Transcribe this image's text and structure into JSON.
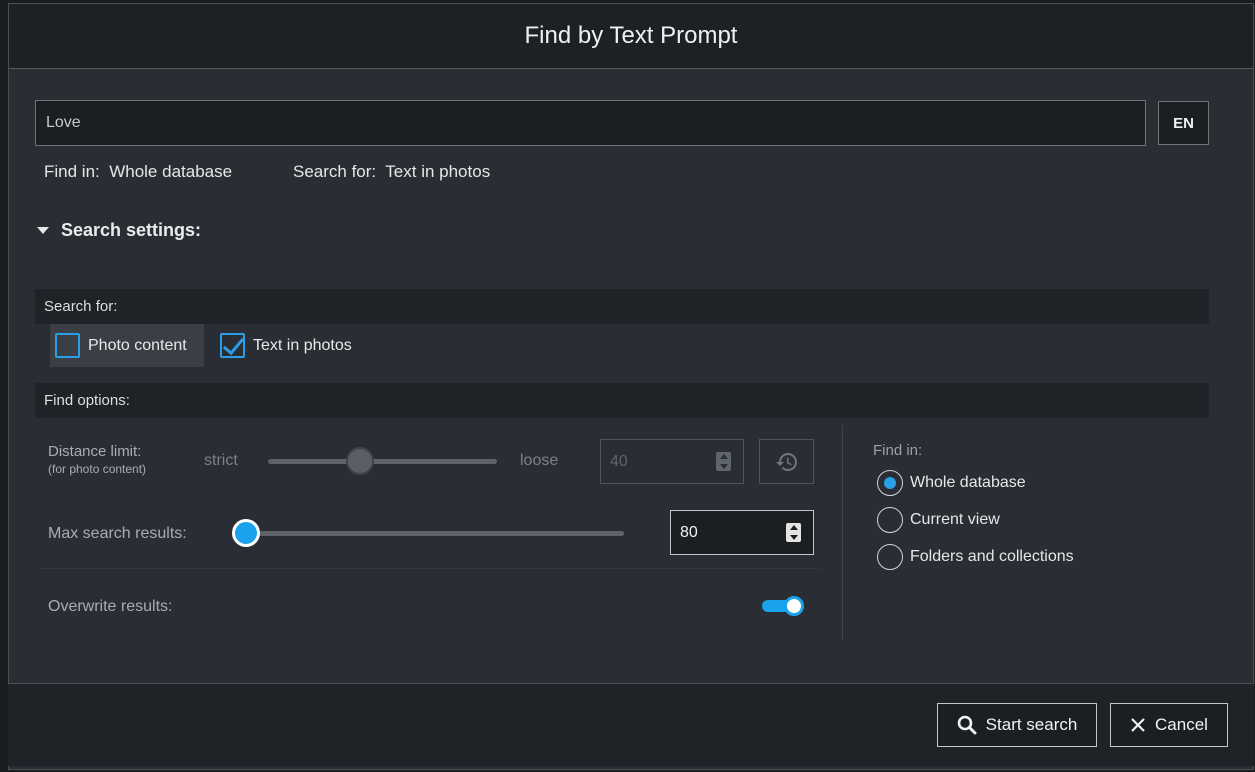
{
  "dialog": {
    "title": "Find by Text Prompt"
  },
  "prompt": {
    "value": "Love",
    "language_button": "EN"
  },
  "summary": {
    "find_in_label": "Find in:",
    "find_in_value": "Whole database",
    "search_for_label": "Search for:",
    "search_for_value": "Text in photos"
  },
  "settings": {
    "toggle_label": "Search settings:",
    "expanded": true
  },
  "search_for_section": {
    "header": "Search for:",
    "options": [
      {
        "label": "Photo content",
        "checked": false
      },
      {
        "label": "Text in photos",
        "checked": true
      }
    ]
  },
  "find_options": {
    "header": "Find options:",
    "distance_limit": {
      "label": "Distance limit:",
      "sublabel": "(for photo content)",
      "min_label": "strict",
      "max_label": "loose",
      "value": "40",
      "enabled": false
    },
    "max_results": {
      "label": "Max search results:",
      "value": "80"
    },
    "overwrite": {
      "label": "Overwrite results:",
      "on": true
    },
    "find_in": {
      "label": "Find in:",
      "options": [
        {
          "label": "Whole database",
          "selected": true
        },
        {
          "label": "Current view",
          "selected": false
        },
        {
          "label": "Folders and collections",
          "selected": false
        }
      ]
    }
  },
  "footer": {
    "start_label": "Start search",
    "cancel_label": "Cancel"
  },
  "colors": {
    "accent": "#1aa3ec",
    "background": "#2a2e34",
    "header_bg": "#1e2124"
  },
  "icons": [
    "triangle-down-icon",
    "checkbox-icon",
    "spinner-arrows-icon",
    "history-icon",
    "search-icon",
    "close-icon"
  ]
}
